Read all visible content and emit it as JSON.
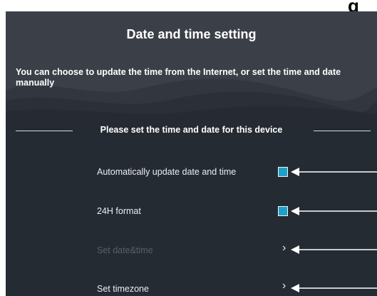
{
  "corner_text": "g",
  "page": {
    "title": "Date and time setting",
    "description": "You can choose to update the time from the Internet, or set the time and date manually",
    "section_heading": "Please set the time and date for this device"
  },
  "settings": {
    "auto_update": {
      "label": "Automatically update date and time",
      "checked": true
    },
    "format_24h": {
      "label": "24H format",
      "checked": true
    },
    "set_date_time": {
      "label": "Set date&time",
      "enabled": false,
      "chevron": "›"
    },
    "set_timezone": {
      "label": "Set timezone",
      "chevron": "›"
    }
  },
  "colors": {
    "panel": "#252b33",
    "header": "#3b4048",
    "checkbox_fill": "#1fa1c7",
    "disabled_text": "#5a6068"
  },
  "icons": {
    "chevron": "chevron-right-icon",
    "callout": "arrow-left-icon"
  }
}
